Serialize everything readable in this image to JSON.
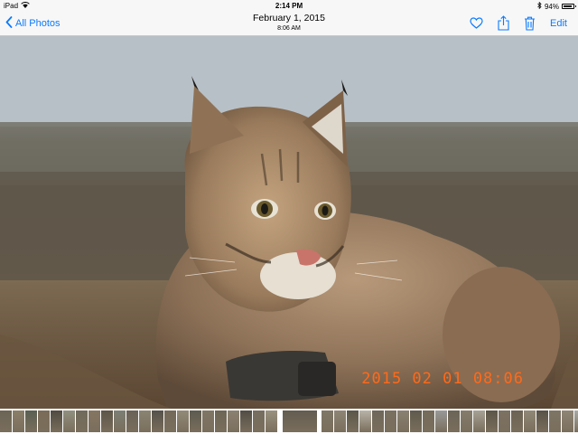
{
  "status_bar": {
    "device": "iPad",
    "time": "2:14 PM",
    "battery_percent": "94%",
    "battery_level": 0.94
  },
  "nav": {
    "back_label": "All Photos",
    "title": "February 1, 2015",
    "subtitle": "8:06 AM",
    "edit_label": "Edit",
    "icons": [
      "heart-icon",
      "share-icon",
      "trash-icon"
    ]
  },
  "photo": {
    "date_stamp": "2015 02 01 08:06"
  },
  "colors": {
    "accent": "#0a7aff",
    "date_stamp": "#ff6a1a",
    "bar_background": "#f7f7f7"
  },
  "filmstrip": {
    "thumb_colors": [
      "#6b6455",
      "#8b7f6a",
      "#5a5f52",
      "#7a6c58",
      "#4f4a40",
      "#909080",
      "#6f6a5c",
      "#857662",
      "#5d5548",
      "#7c7f75",
      "#6a6258",
      "#8a8474",
      "#55514a",
      "#746a5a",
      "#938a78",
      "#5c5a50",
      "#807666",
      "#6d6656",
      "#8c8272",
      "#514d44",
      "#776e60",
      "#9a917f",
      "#625c50",
      "#7f7767",
      "#8e8576",
      "#5a5649",
      "#b8b3a8",
      "#6e675a",
      "#7a7060",
      "#8a8172",
      "#5e5a4d",
      "#756b5b",
      "#999",
      "#6a6458",
      "#857c6c",
      "#a6a196",
      "#5b5548",
      "#7c7262",
      "#6c6354",
      "#918877",
      "#585247",
      "#7e7565",
      "#8f8676",
      "#a9aaa4",
      "#6b6559",
      "#7d7363",
      "#c7c4bc",
      "#645e52",
      "#837a6a",
      "#5f584c",
      "#7b7262",
      "#8d8474",
      "#6a6255",
      "#7f7666",
      "#9b9282",
      "#5d574b",
      "#796f5f",
      "#8b8272",
      "#646054",
      "#7e7464"
    ]
  }
}
